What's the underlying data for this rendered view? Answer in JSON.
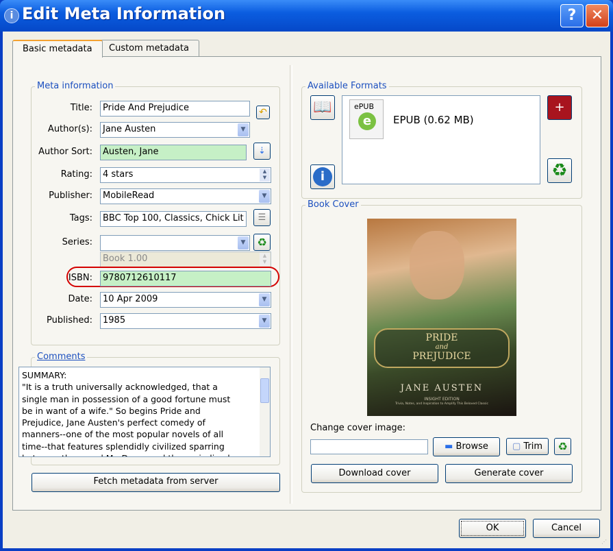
{
  "window": {
    "title": "Edit Meta Information",
    "help": "?",
    "close": "✕"
  },
  "tabs": [
    {
      "label": "Basic metadata"
    },
    {
      "label": "Custom metadata"
    }
  ],
  "meta": {
    "group_label": "Meta information",
    "title_label": "Title:",
    "title_value": "Pride And Prejudice",
    "authors_label": "Author(s):",
    "authors_value": "Jane Austen",
    "author_sort_label": "Author Sort:",
    "author_sort_value": "Austen, Jane",
    "rating_label": "Rating:",
    "rating_value": "4 stars",
    "publisher_label": "Publisher:",
    "publisher_value": "MobileRead",
    "tags_label": "Tags:",
    "tags_value": "BBC Top 100, Classics, Chick Lit",
    "series_label": "Series:",
    "series_value": "",
    "series_index_value": "Book 1.00",
    "isbn_label": "ISBN:",
    "isbn_value": "9780712610117",
    "date_label": "Date:",
    "date_value": "10 Apr 2009",
    "published_label": "Published:",
    "published_value": "1985"
  },
  "comments": {
    "group_label": "Comments",
    "text": "SUMMARY:\n\"It is a truth universally acknowledged, that a single man in possession of a good fortune must be in want of a wife.\" So begins Pride and Prejudice, Jane Austen's perfect comedy of manners--one of the most popular novels of all time--that features splendidly civilized sparring between the proud Mr. Darcy and the prejudiced Elizabeth Bennet as they"
  },
  "fetch_button": "Fetch metadata from server",
  "formats": {
    "group_label": "Available Formats",
    "items": [
      {
        "badge": "ePUB",
        "label": "EPUB (0.62 MB)"
      }
    ]
  },
  "cover": {
    "group_label": "Book Cover",
    "change_label": "Change cover image:",
    "path_value": "",
    "browse": "Browse",
    "trim": "Trim",
    "download": "Download cover",
    "generate": "Generate cover",
    "image_text": {
      "title1": "PRIDE",
      "and": "and",
      "title2": "PREJUDICE",
      "author": "JANE AUSTEN",
      "edition": "INSIGHT EDITION",
      "tagline": "Trivia, Notes, and Inspiration to Amplify This Beloved Classic"
    }
  },
  "dialog": {
    "ok": "OK",
    "cancel": "Cancel"
  },
  "colors": {
    "titlebar": "#0b5de0",
    "accent": "#1b4fbf",
    "green_field": "#c6f0c6",
    "highlight_ring": "#d40000"
  }
}
